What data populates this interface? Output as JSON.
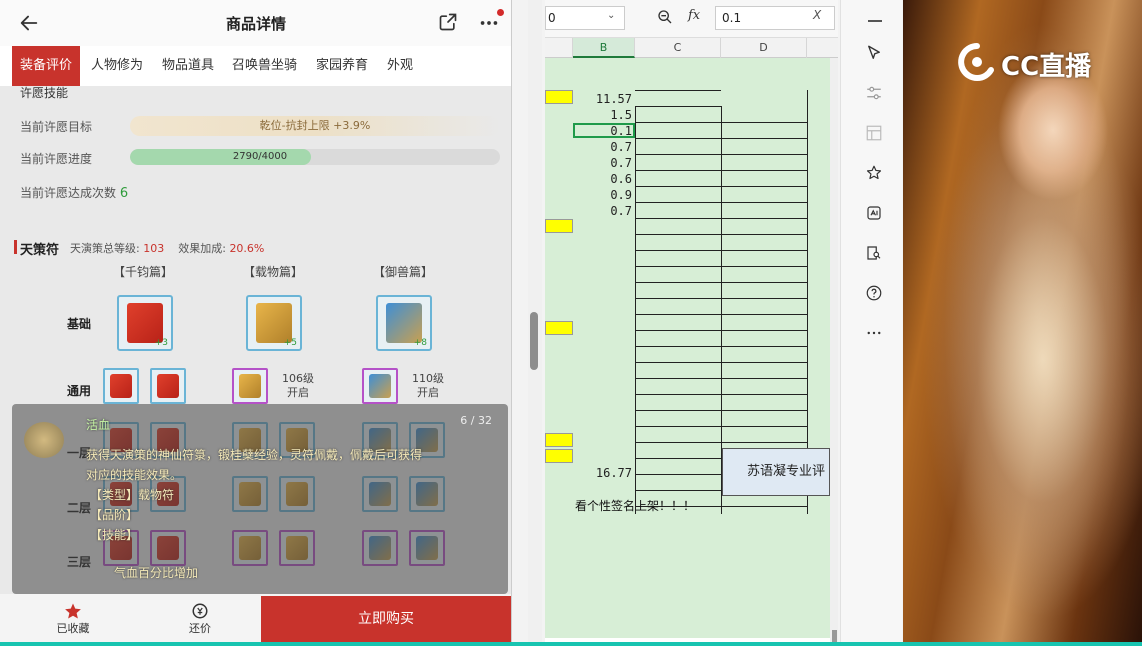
{
  "shop": {
    "title": "商品详情",
    "tabs": [
      "装备评价",
      "人物修为",
      "物品道具",
      "召唤兽坐骑",
      "家园养育",
      "外观"
    ],
    "wish_skill_label": "许愿技能",
    "wish_target_label": "当前许愿目标",
    "wish_target_value": "乾位-抗封上限 +3.9%",
    "wish_progress_label": "当前许愿进度",
    "wish_progress_text": "2790/4000",
    "wish_progress": {
      "current": 2790,
      "total": 4000
    },
    "wish_count_label": "当前许愿达成次数",
    "wish_count_value": "6",
    "tiance": {
      "title": "天策符",
      "level_label": "天演策总等级:",
      "level_value": "103",
      "bonus_label": "效果加成:",
      "bonus_value": "20.6%",
      "columns": [
        "【千钧篇】",
        "【载物篇】",
        "【御兽篇】"
      ],
      "rows": [
        "基础",
        "通用",
        "一层",
        "二层",
        "三层"
      ],
      "base_plus": [
        "+3",
        "+5",
        "+8"
      ],
      "general_unlock_1_level": "106级",
      "general_unlock_1_text": "开启",
      "general_unlock_2_level": "110级",
      "general_unlock_2_text": "开启"
    },
    "overlay": {
      "page": "6 / 32",
      "name": "活血",
      "desc_1": "获得天演策的神仙符箓，锻桂蘖经验，灵符佩戴，佩戴后可获得",
      "desc_2": "对应的技能效果。",
      "type_line": "【类型】载物符",
      "belong_line": "【品阶】",
      "skill_line": "【技能】",
      "effect_line": "气血百分比增加"
    },
    "bottom": {
      "fav_label": "已收藏",
      "bargain_label": "还价",
      "buy_label": "立即购买"
    }
  },
  "sheet": {
    "name_box": "0",
    "formula_value": "0.1",
    "columns": [
      "B",
      "C",
      "D"
    ],
    "values": [
      "11.57",
      "1.5",
      "0.1",
      "0.7",
      "0.7",
      "0.6",
      "0.9",
      "0.7"
    ],
    "total_value": "16.77",
    "merged_text": "苏语凝专业评",
    "note_text": "看个性签名上架！！！"
  },
  "stream": {
    "logo_text": "CC直播"
  },
  "colors": {
    "accent_red": "#c8332c",
    "sheet_green": "#d7eed6",
    "highlight_yellow": "#ffff00",
    "selection_green": "#1f9a4a"
  }
}
